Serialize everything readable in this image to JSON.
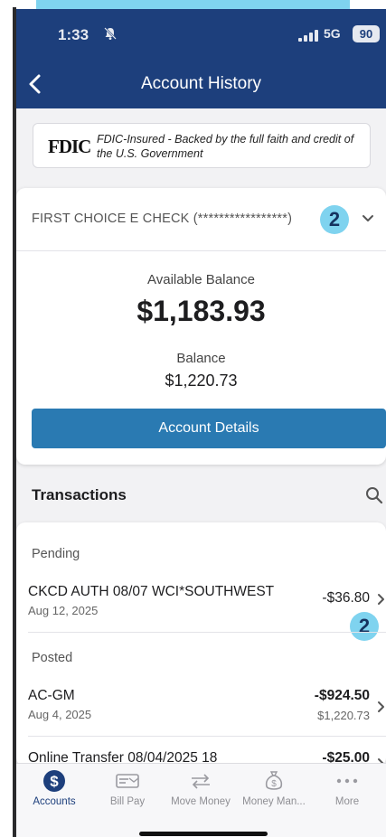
{
  "status_bar": {
    "time": "1:33",
    "network": "5G",
    "battery": "90"
  },
  "header": {
    "title": "Account History"
  },
  "fdic": {
    "logo": "FDIC",
    "text": "FDIC-Insured - Backed by the full faith and credit of the U.S. Government"
  },
  "account": {
    "name": "FIRST CHOICE E CHECK (*****************)",
    "badge": "2",
    "available_label": "Available Balance",
    "available_value": "$1,183.93",
    "balance_label": "Balance",
    "balance_value": "$1,220.73",
    "details_button": "Account Details"
  },
  "transactions": {
    "title": "Transactions",
    "pending_label": "Pending",
    "posted_label": "Posted",
    "pending": [
      {
        "description": "CKCD AUTH 08/07 WCI*SOUTHWEST",
        "date": "Aug 12, 2025",
        "amount": "-$36.80",
        "badge": "2"
      }
    ],
    "posted": [
      {
        "description": "AC-GM",
        "date": "Aug 4, 2025",
        "amount": "-$924.50",
        "balance": "$1,220.73"
      },
      {
        "description": "Online Transfer 08/04/2025 18",
        "date": "",
        "amount": "-$25.00",
        "balance": ""
      }
    ]
  },
  "tabs": [
    {
      "label": "Accounts",
      "icon": "dollar-circle-icon",
      "active": true
    },
    {
      "label": "Bill Pay",
      "icon": "bill-icon",
      "active": false
    },
    {
      "label": "Move Money",
      "icon": "transfer-arrows-icon",
      "active": false
    },
    {
      "label": "Money Man...",
      "icon": "money-bag-icon",
      "active": false
    },
    {
      "label": "More",
      "icon": "more-dots-icon",
      "active": false
    }
  ],
  "colors": {
    "header": "#1d3f7c",
    "accent_button": "#2a7ab2",
    "badge": "#7fd3ef",
    "active_tab": "#1d3f7c"
  }
}
